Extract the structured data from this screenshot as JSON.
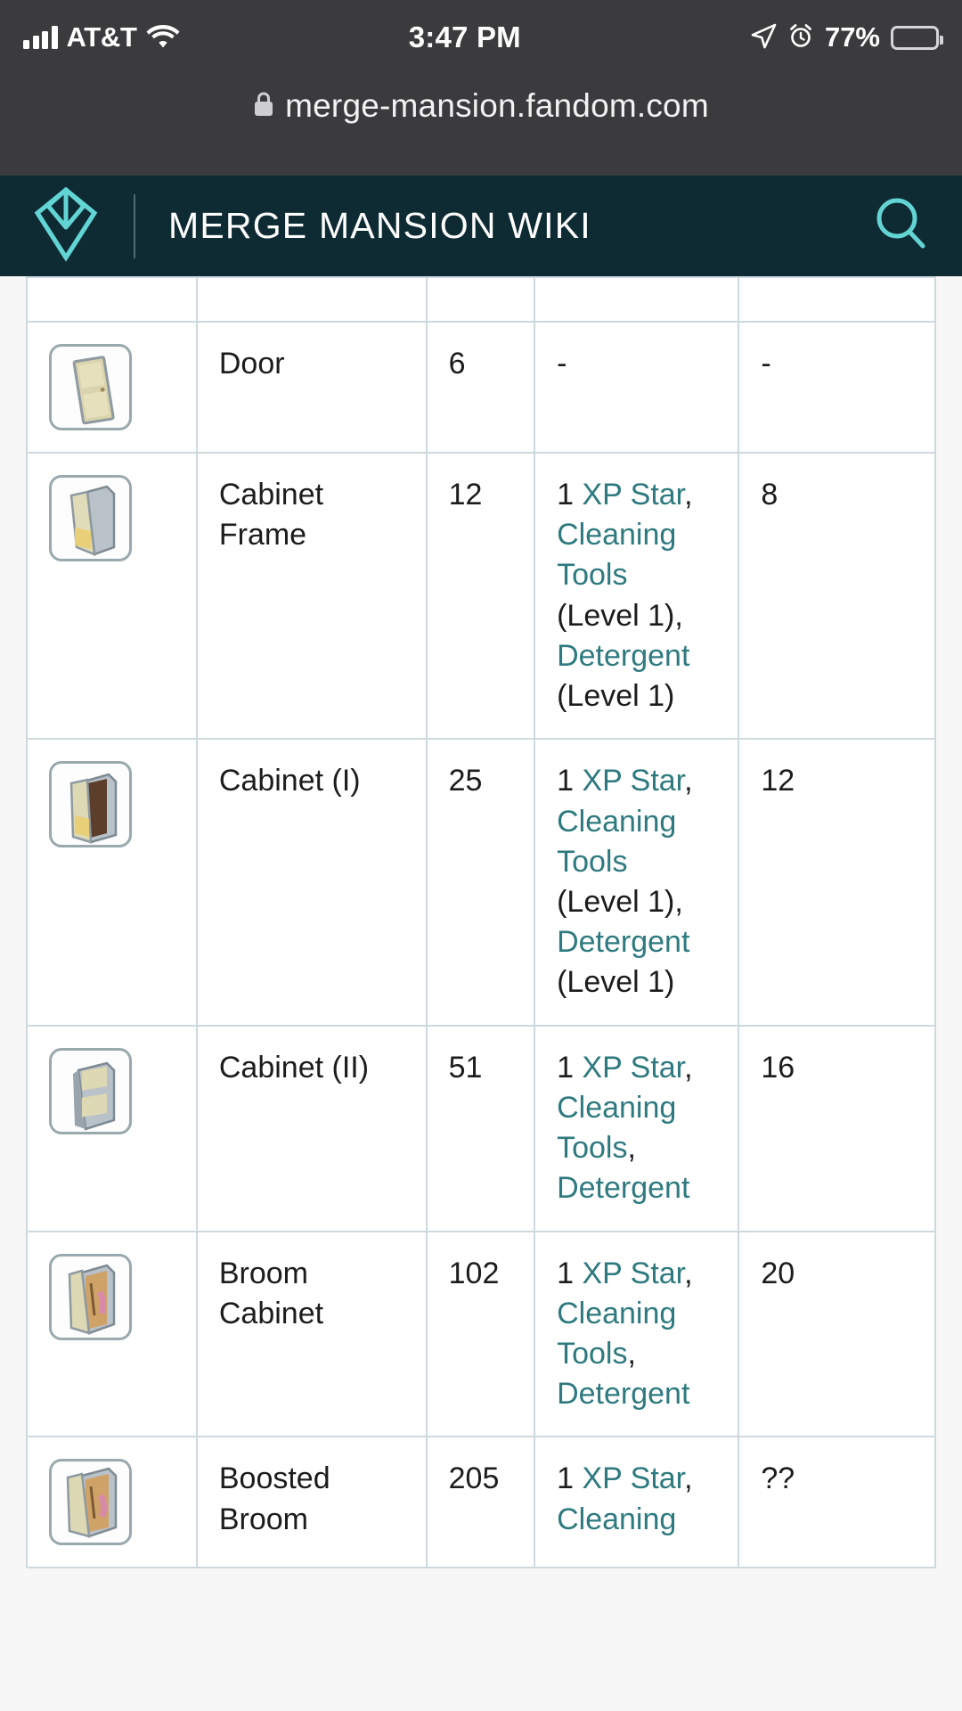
{
  "status_bar": {
    "carrier": "AT&T",
    "time": "3:47 PM",
    "battery_percent": "77%",
    "icons": [
      "signal-bars-icon",
      "wifi-icon",
      "location-arrow-icon",
      "alarm-clock-icon",
      "battery-icon"
    ]
  },
  "browser": {
    "url": "merge-mansion.fandom.com",
    "lock_icon": "lock-icon"
  },
  "site_header": {
    "logo": "fandom-heart-logo",
    "title": "MERGE MANSION WIKI",
    "search_icon": "search-icon"
  },
  "table": {
    "rows": [
      {
        "icon": "door-item-icon",
        "name": "Door",
        "level": "6",
        "requirements": [
          {
            "text": "-",
            "link": false
          }
        ],
        "xp": "-"
      },
      {
        "icon": "cabinet-frame-item-icon",
        "name": "Cabinet Frame",
        "level": "12",
        "requirements": [
          {
            "text": "1 ",
            "link": false
          },
          {
            "text": "XP Star",
            "link": true
          },
          {
            "text": ", ",
            "link": false
          },
          {
            "text": "Cleaning Tools",
            "link": true
          },
          {
            "text": " (Level 1), ",
            "link": false
          },
          {
            "text": "Detergent",
            "link": true
          },
          {
            "text": " (Level 1)",
            "link": false
          }
        ],
        "xp": "8"
      },
      {
        "icon": "cabinet-1-item-icon",
        "name": "Cabinet (I)",
        "level": "25",
        "requirements": [
          {
            "text": "1 ",
            "link": false
          },
          {
            "text": "XP Star",
            "link": true
          },
          {
            "text": ", ",
            "link": false
          },
          {
            "text": "Cleaning Tools",
            "link": true
          },
          {
            "text": " (Level 1), ",
            "link": false
          },
          {
            "text": "Detergent",
            "link": true
          },
          {
            "text": " (Level 1)",
            "link": false
          }
        ],
        "xp": "12"
      },
      {
        "icon": "cabinet-2-item-icon",
        "name": "Cabinet (II)",
        "level": "51",
        "requirements": [
          {
            "text": "1 ",
            "link": false
          },
          {
            "text": "XP Star",
            "link": true
          },
          {
            "text": ", ",
            "link": false
          },
          {
            "text": "Cleaning Tools",
            "link": true
          },
          {
            "text": ", ",
            "link": false
          },
          {
            "text": "Detergent",
            "link": true
          }
        ],
        "xp": "16"
      },
      {
        "icon": "broom-cabinet-item-icon",
        "name": "Broom Cabinet",
        "level": "102",
        "requirements": [
          {
            "text": "1 ",
            "link": false
          },
          {
            "text": "XP Star",
            "link": true
          },
          {
            "text": ", ",
            "link": false
          },
          {
            "text": "Cleaning Tools",
            "link": true
          },
          {
            "text": ", ",
            "link": false
          },
          {
            "text": "Detergent",
            "link": true
          }
        ],
        "xp": "20"
      },
      {
        "icon": "boosted-broom-cabinet-item-icon",
        "name": "Boosted Broom",
        "level": "205",
        "requirements": [
          {
            "text": "1 ",
            "link": false
          },
          {
            "text": "XP Star",
            "link": true
          },
          {
            "text": ", ",
            "link": false
          },
          {
            "text": "Cleaning",
            "link": true
          }
        ],
        "xp": "??"
      }
    ]
  },
  "colors": {
    "header_bg": "#0e2b33",
    "link_teal": "#2e7a7f",
    "logo_teal": "#63d4d4",
    "chrome_bg": "#3b3b3d",
    "table_border": "#cdd9dc"
  }
}
